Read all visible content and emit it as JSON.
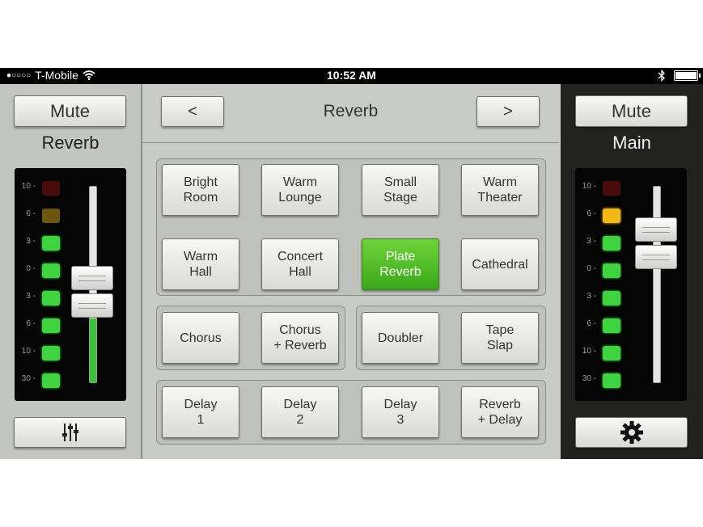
{
  "status_bar": {
    "signal": "●○○○○",
    "carrier": "T-Mobile",
    "time": "10:52 AM"
  },
  "left_channel": {
    "mute_label": "Mute",
    "name": "Reverb",
    "meter_labels": [
      "10 -",
      "6 -",
      "3 -",
      "0 -",
      "3 -",
      "6 -",
      "10 -",
      "30 -"
    ],
    "meter_leds": [
      "red-dim",
      "yellow-dim",
      "green",
      "green",
      "green",
      "green",
      "green",
      "green"
    ],
    "fader_level_fraction": 0.45,
    "settings_icon": "mixer-sliders-icon"
  },
  "center": {
    "prev_label": "<",
    "title": "Reverb",
    "next_label": ">",
    "presets": [
      {
        "label": "Bright\nRoom",
        "line1": "Bright",
        "line2": "Room"
      },
      {
        "line1": "Warm",
        "line2": "Lounge"
      },
      {
        "line1": "Small",
        "line2": "Stage"
      },
      {
        "line1": "Warm",
        "line2": "Theater"
      },
      {
        "line1": "Warm",
        "line2": "Hall"
      },
      {
        "line1": "Concert",
        "line2": "Hall"
      },
      {
        "line1": "Plate",
        "line2": "Reverb",
        "active": true
      },
      {
        "line1": "Cathedral",
        "line2": ""
      },
      {
        "line1": "Chorus",
        "line2": ""
      },
      {
        "line1": "Chorus",
        "line2": "+ Reverb"
      },
      {
        "line1": "Doubler",
        "line2": ""
      },
      {
        "line1": "Tape",
        "line2": "Slap"
      },
      {
        "line1": "Delay",
        "line2": "1"
      },
      {
        "line1": "Delay",
        "line2": "2"
      },
      {
        "line1": "Delay",
        "line2": "3"
      },
      {
        "line1": "Reverb",
        "line2": "+ Delay"
      }
    ]
  },
  "right_channel": {
    "mute_label": "Mute",
    "name": "Main",
    "meter_labels": [
      "10 -",
      "6 -",
      "3 -",
      "0 -",
      "3 -",
      "6 -",
      "10 -",
      "30 -"
    ],
    "meter_leds": [
      "red-dim",
      "yellow",
      "green",
      "green",
      "green",
      "green",
      "green",
      "green"
    ],
    "fader_level_fraction": 0.7,
    "settings_icon": "gear-icon"
  },
  "colors": {
    "led_green": "#3fd43f",
    "led_yellow": "#f2b816",
    "led_red_dim": "#4a0b0b",
    "led_yellow_dim": "#6e5510",
    "active_preset": "#4fbf25"
  }
}
